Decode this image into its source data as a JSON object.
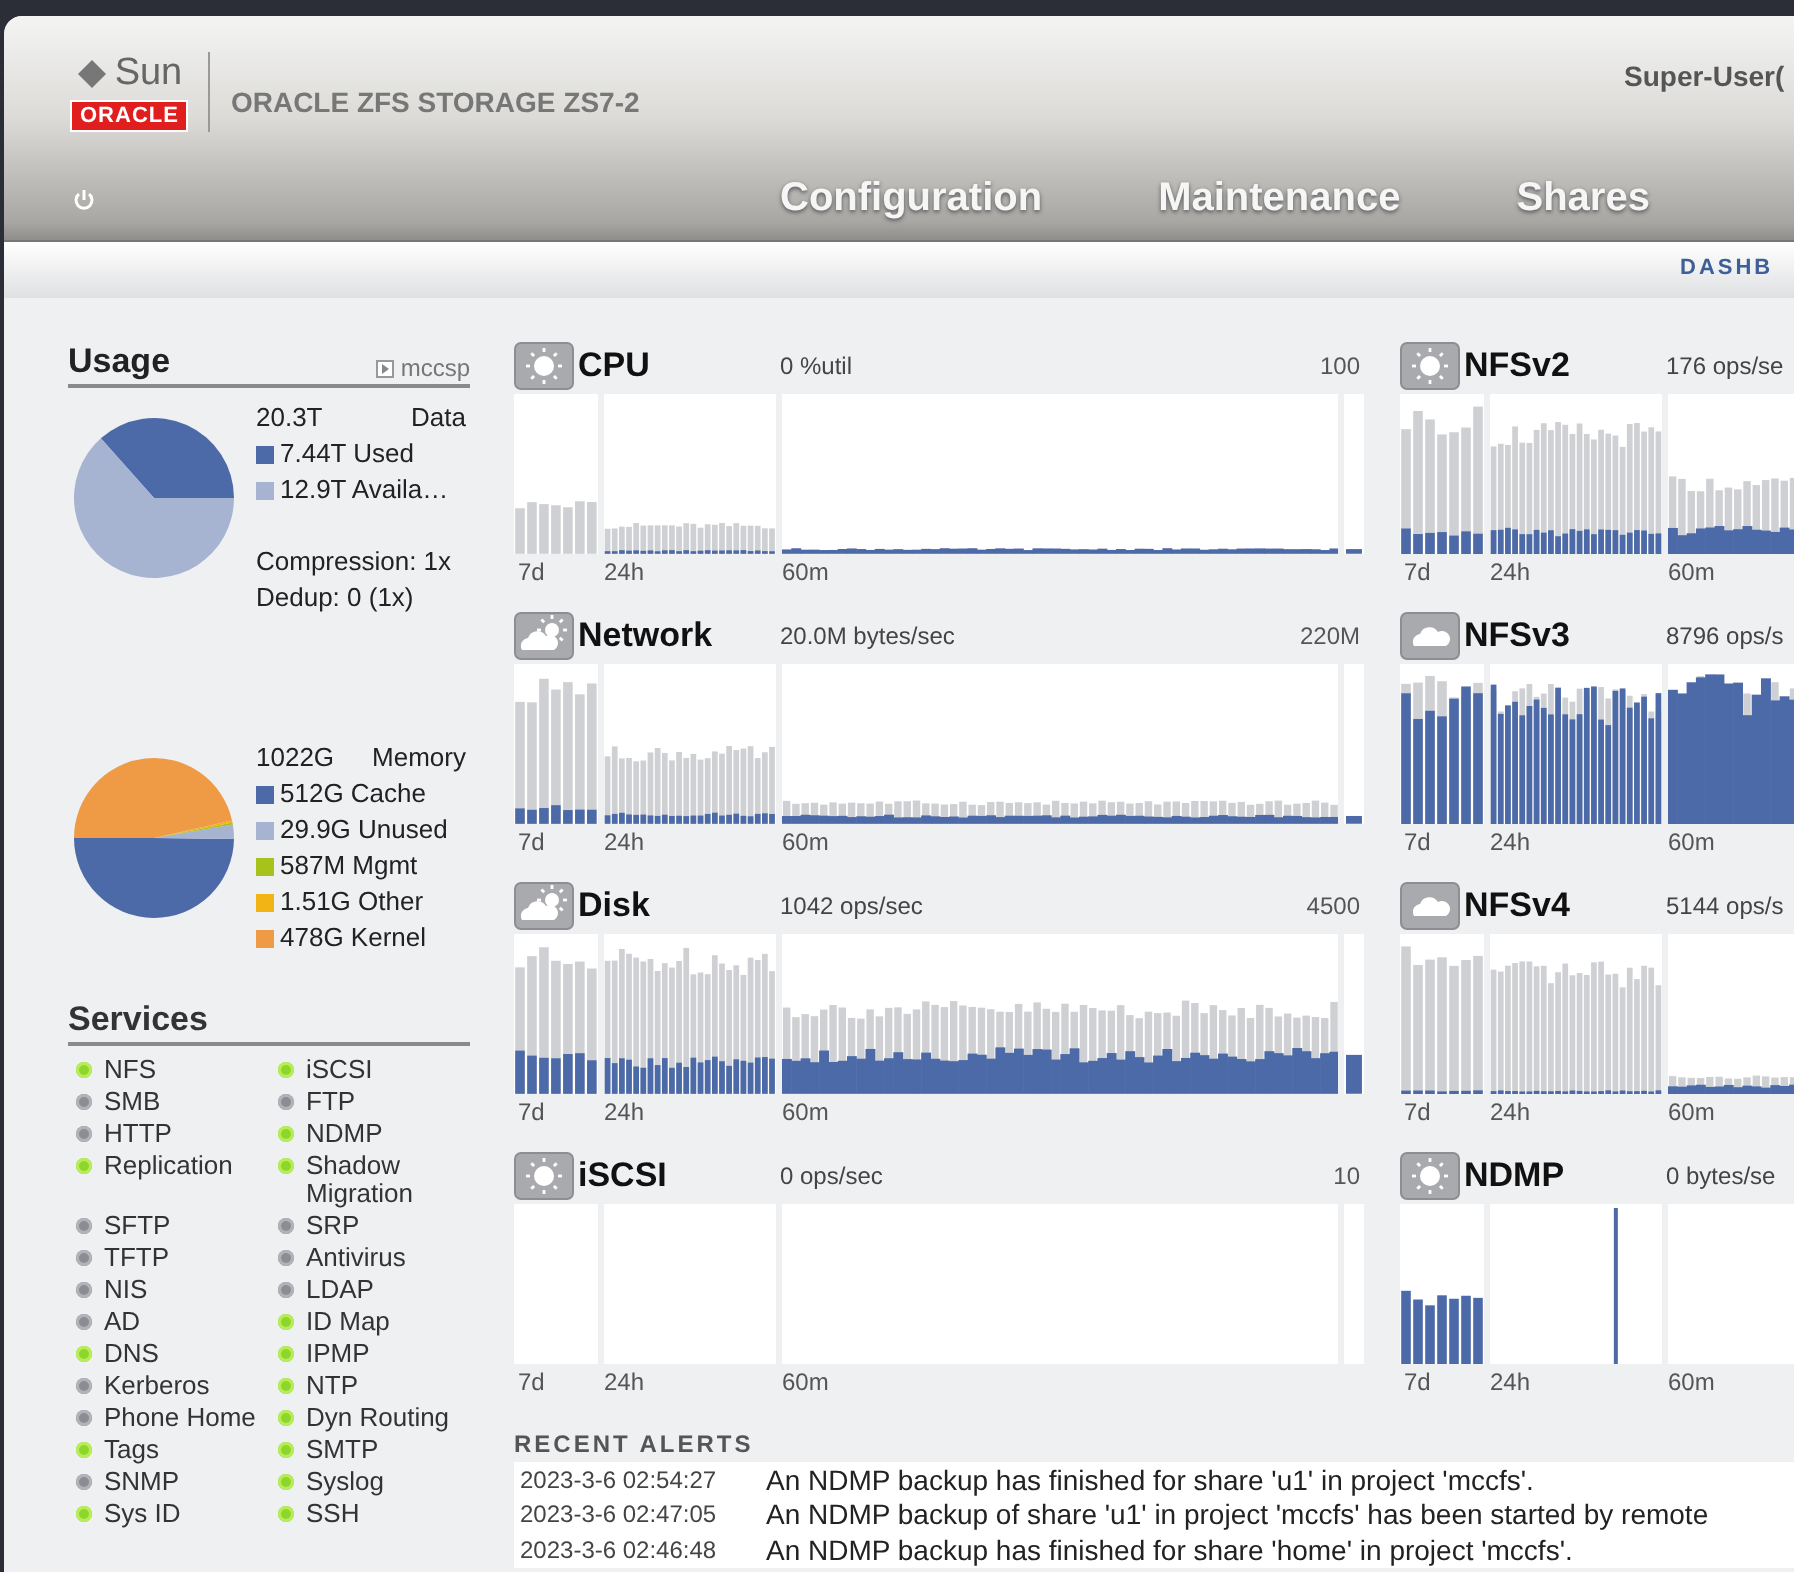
{
  "header": {
    "logo_top": "Sun",
    "logo_bottom": "ORACLE",
    "product": "ORACLE ZFS STORAGE ZS7-2",
    "user": "Super-User(",
    "nav": [
      {
        "label": "Configuration",
        "selected": false
      },
      {
        "label": "Maintenance",
        "selected": false
      },
      {
        "label": "Shares",
        "selected": false
      }
    ],
    "subnav": "DASHB"
  },
  "usage": {
    "title": "Usage",
    "pool": "mccsp",
    "data": {
      "total": "20.3T",
      "label": "Data",
      "legend": [
        {
          "text": "7.44T Used",
          "color": "#4d6aa8"
        },
        {
          "text": "12.9T Availa…",
          "color": "#a6b4d2"
        }
      ],
      "chart_data": {
        "type": "pie",
        "values": [
          36.58,
          63.42
        ]
      }
    },
    "compression": "Compression: 1x",
    "dedup": "Dedup: 0 (1x)",
    "memory": {
      "total": "1022G",
      "label": "Memory",
      "legend": [
        {
          "text": "512G Cache",
          "color": "#4d6aa8"
        },
        {
          "text": "29.9G Unused",
          "color": "#a6b4d2"
        },
        {
          "text": "587M Mgmt",
          "color": "#a8c21c"
        },
        {
          "text": "1.51G Other",
          "color": "#f2b414"
        },
        {
          "text": "478G Kernel",
          "color": "#ef9a45"
        }
      ],
      "chart_data": {
        "type": "pie",
        "values": [
          50.09,
          2.93,
          0.06,
          0.15,
          46.77
        ]
      }
    }
  },
  "services": {
    "title": "Services",
    "items": [
      {
        "name": "NFS",
        "on": true
      },
      {
        "name": "iSCSI",
        "on": true
      },
      {
        "name": "SMB",
        "on": false
      },
      {
        "name": "FTP",
        "on": false
      },
      {
        "name": "HTTP",
        "on": false
      },
      {
        "name": "NDMP",
        "on": true
      },
      {
        "name": "Replication",
        "on": true
      },
      {
        "name": "Shadow Migration",
        "on": true
      },
      {
        "name": "SFTP",
        "on": false
      },
      {
        "name": "SRP",
        "on": false
      },
      {
        "name": "TFTP",
        "on": false
      },
      {
        "name": "Antivirus",
        "on": false
      },
      {
        "name": "NIS",
        "on": false
      },
      {
        "name": "LDAP",
        "on": false
      },
      {
        "name": "AD",
        "on": false
      },
      {
        "name": "ID Map",
        "on": true
      },
      {
        "name": "DNS",
        "on": true
      },
      {
        "name": "IPMP",
        "on": true
      },
      {
        "name": "Kerberos",
        "on": false
      },
      {
        "name": "NTP",
        "on": true
      },
      {
        "name": "Phone Home",
        "on": false
      },
      {
        "name": "Dyn Routing",
        "on": true
      },
      {
        "name": "Tags",
        "on": true
      },
      {
        "name": "SMTP",
        "on": true
      },
      {
        "name": "SNMP",
        "on": false
      },
      {
        "name": "Syslog",
        "on": true
      },
      {
        "name": "Sys ID",
        "on": true
      },
      {
        "name": "SSH",
        "on": true
      }
    ]
  },
  "charts": [
    {
      "title": "CPU",
      "reading": "0 %util",
      "max": "100",
      "kind": "sunny",
      "ranges": [
        "7d",
        "24h",
        "60m"
      ]
    },
    {
      "title": "NFSv2",
      "reading": "176 ops/se",
      "kind": "sunny",
      "ranges": [
        "7d",
        "24h",
        "60m"
      ]
    },
    {
      "title": "Network",
      "reading": "20.0M bytes/sec",
      "max": "220M",
      "kind": "partly",
      "ranges": [
        "7d",
        "24h",
        "60m"
      ]
    },
    {
      "title": "NFSv3",
      "reading": "8796 ops/s",
      "kind": "cloudy",
      "ranges": [
        "7d",
        "24h",
        "60m"
      ]
    },
    {
      "title": "Disk",
      "reading": "1042 ops/sec",
      "max": "4500",
      "kind": "partly",
      "ranges": [
        "7d",
        "24h",
        "60m"
      ]
    },
    {
      "title": "NFSv4",
      "reading": "5144 ops/s",
      "kind": "cloudy",
      "ranges": [
        "7d",
        "24h",
        "60m"
      ]
    },
    {
      "title": "iSCSI",
      "reading": "0 ops/sec",
      "max": "10",
      "kind": "sunny",
      "ranges": [
        "7d",
        "24h",
        "60m"
      ]
    },
    {
      "title": "NDMP",
      "reading": "0 bytes/se",
      "kind": "sunny",
      "ranges": [
        "7d",
        "24h",
        "60m"
      ]
    }
  ],
  "alerts": {
    "title": "RECENT ALERTS",
    "rows": [
      {
        "time": "2023-3-6 02:54:27",
        "message": "An NDMP backup has finished for share 'u1' in project 'mccfs'."
      },
      {
        "time": "2023-3-6 02:47:05",
        "message": "An NDMP backup of share 'u1' in project 'mccfs' has been started by remote"
      },
      {
        "time": "2023-3-6 02:46:48",
        "message": "An NDMP backup has finished for share 'home' in project 'mccfs'."
      }
    ]
  }
}
